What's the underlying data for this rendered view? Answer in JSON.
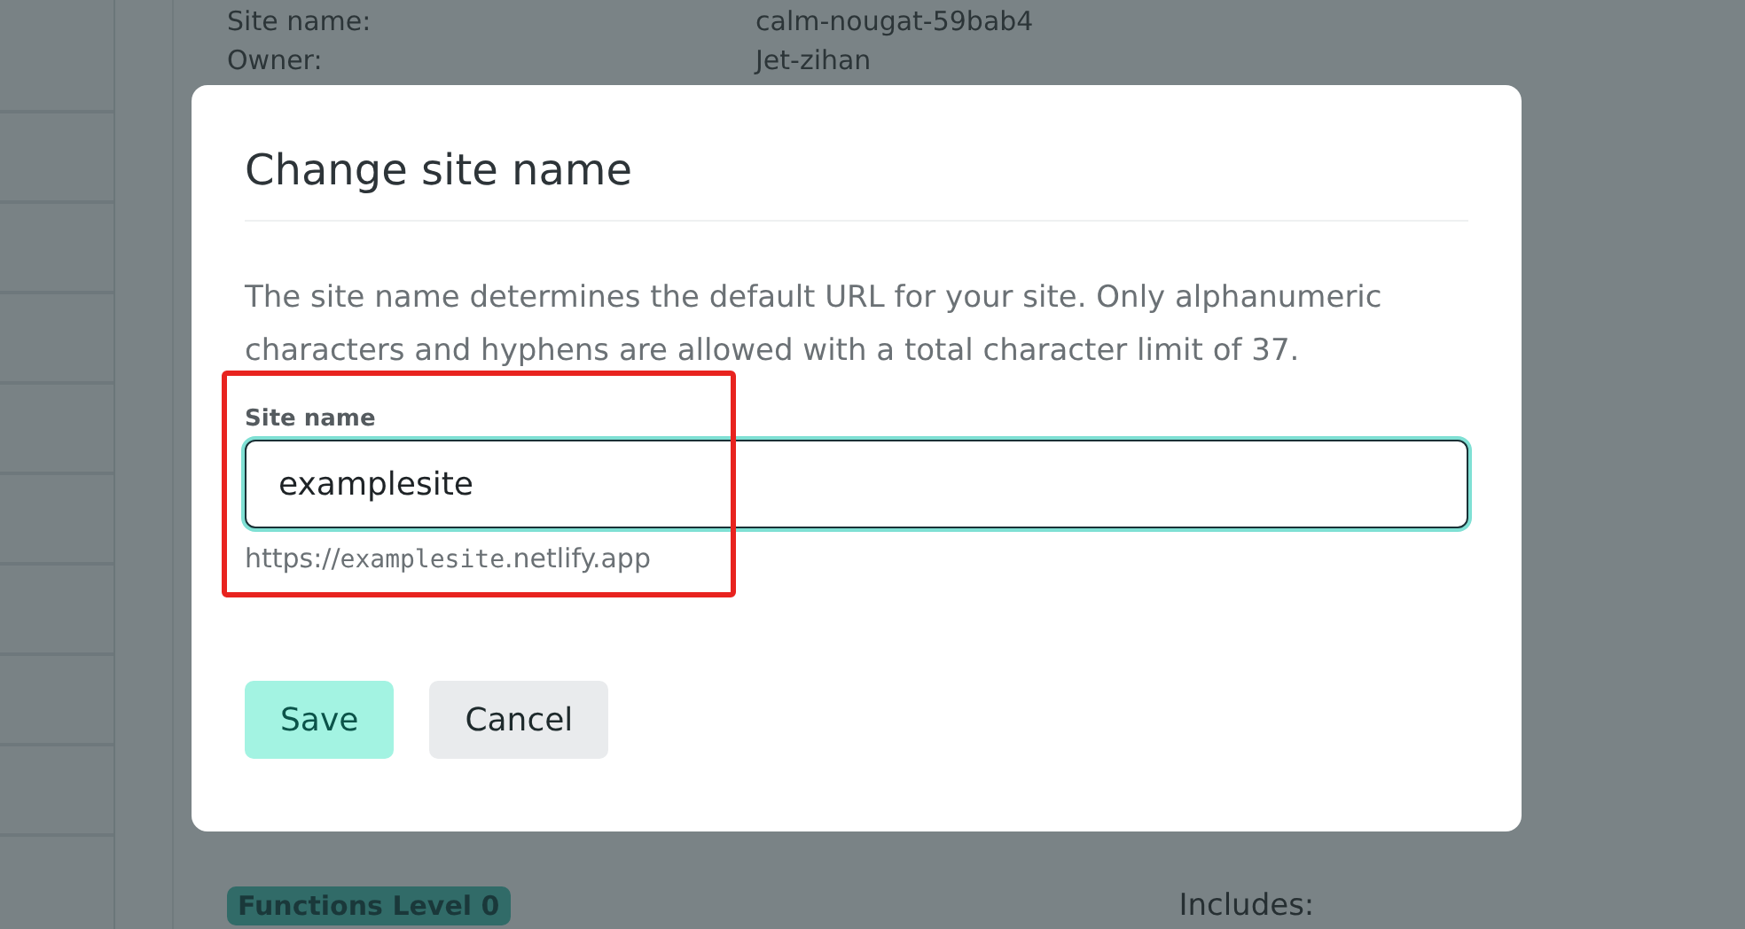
{
  "background": {
    "fields": [
      {
        "label": "Site name:",
        "value": "calm-nougat-59bab4"
      },
      {
        "label": "Owner:",
        "value": "Jet-zihan"
      }
    ],
    "badge": "Functions Level 0",
    "includes_label": "Includes:"
  },
  "dialog": {
    "title": "Change site name",
    "description": "The site name determines the default URL for your site. Only alphanumeric characters and hyphens are allowed with a total character limit of 37.",
    "field": {
      "label": "Site name",
      "value": "examplesite",
      "hint_prefix": "https://",
      "hint_site": "examplesite",
      "hint_suffix": ".netlify.app"
    },
    "buttons": [
      {
        "label": "Save",
        "kind": "primary"
      },
      {
        "label": "Cancel",
        "kind": "secondary"
      }
    ]
  }
}
